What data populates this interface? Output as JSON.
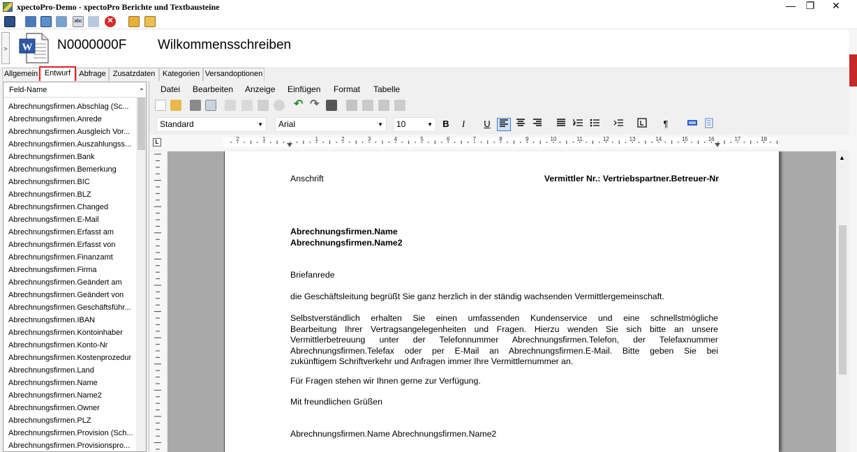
{
  "window": {
    "title": "xpectoPro-Demo - xpectoPro Berichte und Textbausteine",
    "minimize": "—",
    "maximize": "❐",
    "close": "✕"
  },
  "header": {
    "number": "N0000000F",
    "title": "Wilkommensschreiben",
    "expander": ">"
  },
  "tabs": [
    {
      "label": "Allgemein"
    },
    {
      "label": "Entwurf",
      "active": true
    },
    {
      "label": "Abfrage"
    },
    {
      "label": "Zusatzdaten"
    },
    {
      "label": "Kategorien"
    },
    {
      "label": "Versandoptionen"
    }
  ],
  "fieldpanel": {
    "header": "Feld-Name",
    "fields": [
      "Abrechnungsfirmen.Abschlag (Sc...",
      "Abrechnungsfirmen.Anrede",
      "Abrechnungsfirmen.Ausgleich Vor...",
      "Abrechnungsfirmen.Auszahlungss...",
      "Abrechnungsfirmen.Bank",
      "Abrechnungsfirmen.Bemerkung",
      "Abrechnungsfirmen.BIC",
      "Abrechnungsfirmen.BLZ",
      "Abrechnungsfirmen.Changed",
      "Abrechnungsfirmen.E-Mail",
      "Abrechnungsfirmen.Erfasst am",
      "Abrechnungsfirmen.Erfasst von",
      "Abrechnungsfirmen.Finanzamt",
      "Abrechnungsfirmen.Firma",
      "Abrechnungsfirmen.Geändert am",
      "Abrechnungsfirmen.Geändert von",
      "Abrechnungsfirmen.Geschäftsführ...",
      "Abrechnungsfirmen.IBAN",
      "Abrechnungsfirmen.Kontoinhaber",
      "Abrechnungsfirmen.Konto-Nr",
      "Abrechnungsfirmen.Kostenprozedur",
      "Abrechnungsfirmen.Land",
      "Abrechnungsfirmen.Name",
      "Abrechnungsfirmen.Name2",
      "Abrechnungsfirmen.Owner",
      "Abrechnungsfirmen.PLZ",
      "Abrechnungsfirmen.Provision (Sch...",
      "Abrechnungsfirmen.Provisionspro..."
    ]
  },
  "editor": {
    "menu": [
      "Datei",
      "Bearbeiten",
      "Anzeige",
      "Einfügen",
      "Format",
      "Tabelle"
    ],
    "style": "Standard",
    "font": "Arial",
    "size": "10",
    "format_buttons": {
      "bold": "B",
      "italic": "I",
      "underline": "U",
      "pilcrow": "¶"
    },
    "ruler_labels": [
      "2",
      "1",
      "1",
      "2",
      "3",
      "4",
      "5",
      "6",
      "7",
      "8",
      "9",
      "10",
      "11",
      "12",
      "13",
      "14",
      "15",
      "16",
      "17",
      "18"
    ],
    "document": {
      "anschrift": "Anschrift",
      "vermittler": "Vermittler Nr.: Vertriebspartner.Betreuer-Nr",
      "name": "Abrechnungsfirmen.Name",
      "name2": "Abrechnungsfirmen.Name2",
      "briefanrede": "Briefanrede",
      "p1": "die Geschäftsleitung begrüßt Sie ganz herzlich in der ständig wachsenden Vermittlergemeinschaft.",
      "p2": [
        "Selbstverständlich erhalten Sie einen umfassenden Kundenservice und eine schnellstmögliche",
        "Bearbeitung Ihrer Vertragsangelegenheiten und Fragen. Hierzu wenden Sie sich bitte an unsere",
        "Vermittlerbetreuung unter der Telefonnummer Abrechnungsfirmen.Telefon, der Telefaxnummer",
        "Abrechnungsfirmen.Telefax oder per E-Mail an Abrechnungsfirmen.E-Mail. Bitte geben Sie bei",
        "zukünftigem Schriftverkehr und Anfragen immer Ihre Vermittlernummer an."
      ],
      "p3": "Für Fragen stehen wir Ihnen gerne zur Verfügung.",
      "gruss": "Mit freundlichen Grüßen",
      "signature": "Abrechnungsfirmen.Name Abrechnungsfirmen.Name2"
    }
  },
  "colors": {
    "active_tab_border": "#e02020",
    "selection": "#cde2f7",
    "accent_red": "#c62828"
  }
}
